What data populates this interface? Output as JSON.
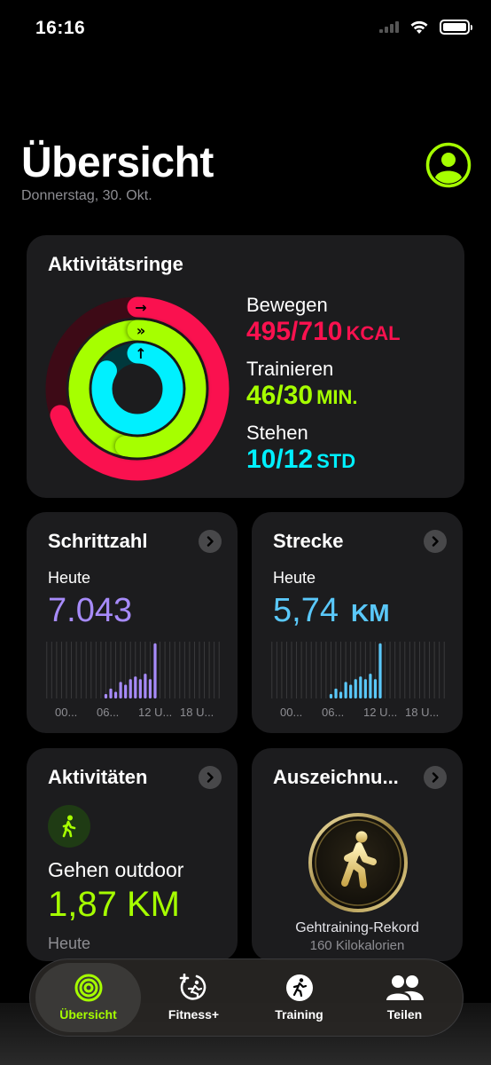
{
  "status_bar": {
    "time": "16:16"
  },
  "header": {
    "title": "Übersicht",
    "date": "Donnerstag, 30. Okt."
  },
  "colors": {
    "move": "#fa114f",
    "exercise": "#a6ff00",
    "stand": "#00f0ff",
    "steps": "#a78bfa",
    "distance": "#5ac8fa"
  },
  "rings": {
    "title": "Aktivitätsringe",
    "move": {
      "label": "Bewegen",
      "value": "495/710",
      "unit": "KCAL",
      "progress": 0.697
    },
    "exercise": {
      "label": "Trainieren",
      "value": "46/30",
      "unit": "MIN.",
      "progress": 1.533
    },
    "stand": {
      "label": "Stehen",
      "value": "10/12",
      "unit": "STD",
      "progress": 0.833
    }
  },
  "steps": {
    "title": "Schrittzahl",
    "period": "Heute",
    "value": "7.043",
    "axis": [
      "00...",
      "06...",
      "12 U...",
      "18 U..."
    ],
    "bars": [
      0,
      0,
      0,
      0,
      0,
      0,
      0,
      0,
      0,
      0,
      0,
      0,
      0.08,
      0.18,
      0.12,
      0.3,
      0.25,
      0.35,
      0.4,
      0.35,
      0.45,
      0.35,
      1.0,
      0,
      0,
      0,
      0,
      0,
      0,
      0,
      0,
      0,
      0,
      0,
      0,
      0
    ]
  },
  "distance": {
    "title": "Strecke",
    "period": "Heute",
    "value": "5,74",
    "unit": "KM",
    "axis": [
      "00...",
      "06...",
      "12 U...",
      "18 U..."
    ],
    "bars": [
      0,
      0,
      0,
      0,
      0,
      0,
      0,
      0,
      0,
      0,
      0,
      0,
      0.08,
      0.18,
      0.12,
      0.3,
      0.25,
      0.35,
      0.4,
      0.35,
      0.45,
      0.35,
      1.0,
      0,
      0,
      0,
      0,
      0,
      0,
      0,
      0,
      0,
      0,
      0,
      0,
      0
    ]
  },
  "activities": {
    "title": "Aktivitäten",
    "icon": "walking-icon",
    "name": "Gehen outdoor",
    "distance": "1,87 KM",
    "day": "Heute"
  },
  "awards": {
    "title": "Auszeichnu...",
    "icon": "walking-medal-icon",
    "name": "Gehtraining-Rekord",
    "sub": "160 Kilokalorien"
  },
  "tabs": [
    {
      "label": "Übersicht",
      "icon": "rings-icon",
      "active": true
    },
    {
      "label": "Fitness+",
      "icon": "fitness-plus-icon",
      "active": false
    },
    {
      "label": "Training",
      "icon": "training-icon",
      "active": false
    },
    {
      "label": "Teilen",
      "icon": "people-icon",
      "active": false
    }
  ]
}
